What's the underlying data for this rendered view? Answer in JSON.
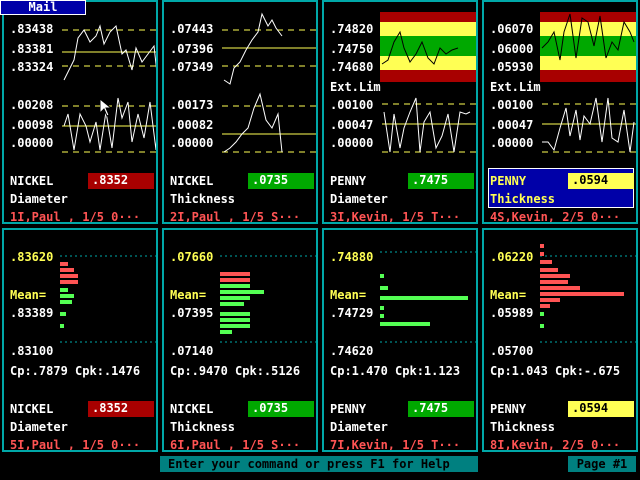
{
  "mail_tab": "Mail",
  "status_prompt": "Enter your command or press F1 for Help",
  "page_label": "Page #1",
  "top_panels": [
    {
      "xbar": [
        ".83438",
        ".83381",
        ".83324"
      ],
      "range": [
        ".00208",
        ".00098",
        ".00000"
      ],
      "ext_label": "",
      "part": "NICKEL",
      "value": ".8352",
      "value_style": "red",
      "feature": "Diameter",
      "footer": "1I,Paul , 1/5 0···"
    },
    {
      "xbar": [
        ".07443",
        ".07396",
        ".07349"
      ],
      "range": [
        ".00173",
        ".00082",
        ".00000"
      ],
      "ext_label": "",
      "part": "NICKEL",
      "value": ".0735",
      "value_style": "green",
      "feature": "Thickness",
      "footer": "2I,Paul , 1/5 S···"
    },
    {
      "xbar": [
        ".74820",
        ".74750",
        ".74680"
      ],
      "range": [
        ".00100",
        ".00047",
        ".00000"
      ],
      "ext_label": "Ext.Lim",
      "part": "PENNY",
      "value": ".7475",
      "value_style": "green",
      "feature": "Diameter",
      "footer": "3I,Kevin, 1/5 T···"
    },
    {
      "xbar": [
        ".06070",
        ".06000",
        ".05930"
      ],
      "range": [
        ".00100",
        ".00047",
        ".00000"
      ],
      "ext_label": "Ext.Lim",
      "part": "PENNY",
      "value": ".0594",
      "value_style": "yellow",
      "feature": "Thickness",
      "footer": "4S,Kevin, 2/5 0···"
    }
  ],
  "bottom_panels": [
    {
      "hist": [
        ".83620",
        ".83389",
        ".83100"
      ],
      "mean_label": "Mean=",
      "cap": "Cp:.7879 Cpk:.1476",
      "part": "NICKEL",
      "value": ".8352",
      "value_style": "red",
      "feature": "Diameter",
      "footer": "5I,Paul , 1/5 0···"
    },
    {
      "hist": [
        ".07660",
        ".07395",
        ".07140"
      ],
      "mean_label": "Mean=",
      "cap": "Cp:.9470 Cpk:.5126",
      "part": "NICKEL",
      "value": ".0735",
      "value_style": "green",
      "feature": "Thickness",
      "footer": "6I,Paul , 1/5 S···"
    },
    {
      "hist": [
        ".74880",
        ".74729",
        ".74620"
      ],
      "mean_label": "Mean=",
      "cap": "Cp:1.470 Cpk:1.123",
      "part": "PENNY",
      "value": ".7475",
      "value_style": "green",
      "feature": "Diameter",
      "footer": "7I,Kevin, 1/5 T···"
    },
    {
      "hist": [
        ".06220",
        ".05989",
        ".05700"
      ],
      "mean_label": "Mean=",
      "cap": "Cp:1.043 Cpk:-.675",
      "part": "PENNY",
      "value": ".0594",
      "value_style": "yellow",
      "feature": "Thickness",
      "footer": "8I,Kevin, 2/5 0···"
    }
  ],
  "colors": {
    "border": "#00a8a8",
    "limit_line": "#ffff54",
    "data_line": "#ffffff",
    "good_point": "#54ff54",
    "bad_point": "#ff5454",
    "status_bg": "#008080"
  }
}
